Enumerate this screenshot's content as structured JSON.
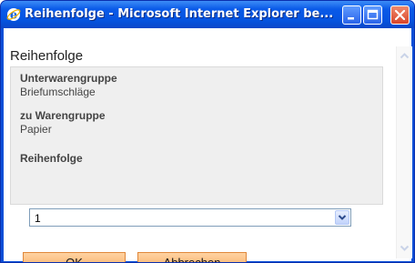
{
  "window": {
    "title": "Reihenfolge - Microsoft Internet Explorer be..."
  },
  "page": {
    "heading": "Reihenfolge"
  },
  "fields": {
    "subgroup_label": "Unterwarengruppe",
    "subgroup_value": "Briefumschläge",
    "group_label": "zu Warengruppe",
    "group_value": "Papier",
    "order_label": "Reihenfolge",
    "order_value": "1"
  },
  "buttons": {
    "ok_label": "OK",
    "cancel_label": "Abbrechen"
  },
  "icons": {
    "app": "internet-explorer-icon",
    "minimize": "minimize-icon",
    "maximize": "maximize-icon",
    "close": "close-icon",
    "dropdown": "chevron-down-icon",
    "scroll_up": "scroll-up-arrow-icon",
    "scroll_down": "scroll-down-arrow-icon"
  },
  "colors": {
    "titlebar": "#0554e0",
    "button_orange": "#f8a65b",
    "close_red": "#d9452a"
  }
}
